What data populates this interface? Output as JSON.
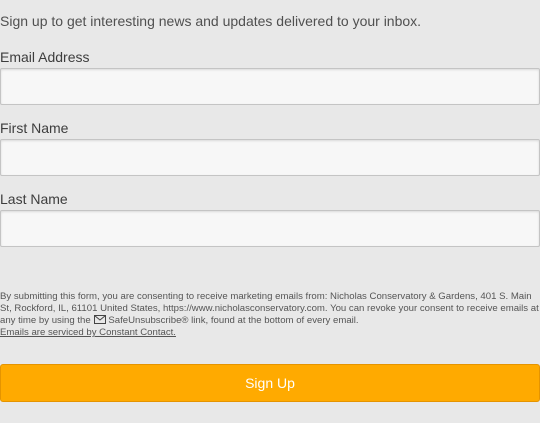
{
  "form": {
    "intro": "Sign up to get interesting news and updates delivered to your inbox.",
    "fields": [
      {
        "label": "Email Address",
        "value": "",
        "placeholder": ""
      },
      {
        "label": "First Name",
        "value": "",
        "placeholder": ""
      },
      {
        "label": "Last Name",
        "value": "",
        "placeholder": ""
      }
    ],
    "legal": {
      "text_before_icon": "By submitting this form, you are consenting to receive marketing emails from: Nicholas Conservatory & Gardens, 401 S. Main St, Rockford, IL, 61101 United States, https://www.nicholasconservatory.com. You can revoke your consent to receive emails at any time by using the",
      "icon": "envelope-icon",
      "text_after_icon": "SafeUnsubscribe® link, found at the bottom of every email.",
      "service_link": "Emails are serviced by Constant Contact."
    },
    "submit_label": "Sign Up",
    "colors": {
      "background": "#e8e8e8",
      "button": "#ffaa00",
      "button_text": "#ffffff"
    }
  }
}
